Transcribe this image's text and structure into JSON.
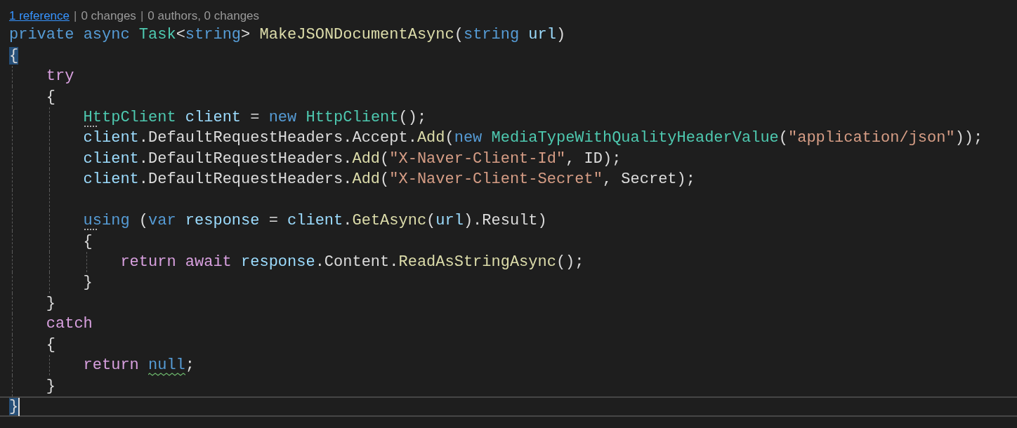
{
  "codelens": [
    {
      "kind": "link",
      "text": "1 reference"
    },
    {
      "kind": "separator",
      "text": "|"
    },
    {
      "kind": "info",
      "text": "0 changes"
    },
    {
      "kind": "separator",
      "text": "|"
    },
    {
      "kind": "info",
      "text": "0 authors, 0 changes"
    }
  ],
  "lines": [
    {
      "kind": "code",
      "tokens": [
        {
          "kind": "keyword",
          "text": "private "
        },
        {
          "kind": "keyword",
          "text": "async "
        },
        {
          "kind": "type",
          "text": "Task"
        },
        {
          "kind": "punct",
          "text": "<"
        },
        {
          "kind": "keyword",
          "text": "string"
        },
        {
          "kind": "punct",
          "text": "> "
        },
        {
          "kind": "method",
          "text": "MakeJSONDocumentAsync"
        },
        {
          "kind": "punct",
          "text": "("
        },
        {
          "kind": "keyword",
          "text": "string "
        },
        {
          "kind": "variable",
          "text": "url"
        },
        {
          "kind": "punct",
          "text": ")"
        }
      ]
    },
    {
      "kind": "code",
      "tokens": [
        {
          "kind": "punct",
          "text": "{",
          "matched": true
        }
      ],
      "children": [
        {
          "kind": "code",
          "tokens": [
            {
              "kind": "control",
              "text": "try"
            }
          ]
        },
        {
          "kind": "code",
          "tokens": [
            {
              "kind": "punct",
              "text": "{"
            }
          ],
          "children": [
            {
              "kind": "code",
              "tokens": [
                {
                  "kind": "type",
                  "text": "HttpClient",
                  "suggestion_dots": true
                },
                {
                  "kind": "variable",
                  "text": " client"
                },
                {
                  "kind": "punct",
                  "text": " = "
                },
                {
                  "kind": "keyword",
                  "text": "new "
                },
                {
                  "kind": "type",
                  "text": "HttpClient"
                },
                {
                  "kind": "punct",
                  "text": "();"
                }
              ]
            },
            {
              "kind": "code",
              "tokens": [
                {
                  "kind": "variable",
                  "text": "client"
                },
                {
                  "kind": "punct",
                  "text": ".DefaultRequestHeaders.Accept."
                },
                {
                  "kind": "method",
                  "text": "Add"
                },
                {
                  "kind": "punct",
                  "text": "("
                },
                {
                  "kind": "keyword",
                  "text": "new "
                },
                {
                  "kind": "type",
                  "text": "MediaTypeWithQualityHeaderValue"
                },
                {
                  "kind": "punct",
                  "text": "("
                },
                {
                  "kind": "string",
                  "text": "\"application/json\""
                },
                {
                  "kind": "punct",
                  "text": "));"
                }
              ]
            },
            {
              "kind": "code",
              "tokens": [
                {
                  "kind": "variable",
                  "text": "client"
                },
                {
                  "kind": "punct",
                  "text": ".DefaultRequestHeaders."
                },
                {
                  "kind": "method",
                  "text": "Add"
                },
                {
                  "kind": "punct",
                  "text": "("
                },
                {
                  "kind": "string",
                  "text": "\"X-Naver-Client-Id\""
                },
                {
                  "kind": "punct",
                  "text": ", ID);"
                }
              ]
            },
            {
              "kind": "code",
              "tokens": [
                {
                  "kind": "variable",
                  "text": "client"
                },
                {
                  "kind": "punct",
                  "text": ".DefaultRequestHeaders."
                },
                {
                  "kind": "method",
                  "text": "Add"
                },
                {
                  "kind": "punct",
                  "text": "("
                },
                {
                  "kind": "string",
                  "text": "\"X-Naver-Client-Secret\""
                },
                {
                  "kind": "punct",
                  "text": ", Secret);"
                }
              ]
            },
            {
              "kind": "blank"
            },
            {
              "kind": "code",
              "tokens": [
                {
                  "kind": "keyword",
                  "text": "using",
                  "suggestion_dots": true
                },
                {
                  "kind": "punct",
                  "text": " ("
                },
                {
                  "kind": "keyword",
                  "text": "var "
                },
                {
                  "kind": "variable",
                  "text": "response"
                },
                {
                  "kind": "punct",
                  "text": " = "
                },
                {
                  "kind": "variable",
                  "text": "client"
                },
                {
                  "kind": "punct",
                  "text": "."
                },
                {
                  "kind": "method",
                  "text": "GetAsync"
                },
                {
                  "kind": "punct",
                  "text": "("
                },
                {
                  "kind": "variable",
                  "text": "url"
                },
                {
                  "kind": "punct",
                  "text": ").Result)"
                }
              ]
            },
            {
              "kind": "code",
              "tokens": [
                {
                  "kind": "punct",
                  "text": "{"
                }
              ],
              "children": [
                {
                  "kind": "code",
                  "tokens": [
                    {
                      "kind": "control",
                      "text": "return "
                    },
                    {
                      "kind": "control",
                      "text": "await "
                    },
                    {
                      "kind": "variable",
                      "text": "response"
                    },
                    {
                      "kind": "punct",
                      "text": ".Content."
                    },
                    {
                      "kind": "method",
                      "text": "ReadAsStringAsync"
                    },
                    {
                      "kind": "punct",
                      "text": "();"
                    }
                  ]
                }
              ]
            },
            {
              "kind": "code",
              "tokens": [
                {
                  "kind": "punct",
                  "text": "}"
                }
              ]
            }
          ]
        },
        {
          "kind": "code",
          "tokens": [
            {
              "kind": "punct",
              "text": "}"
            }
          ]
        },
        {
          "kind": "code",
          "tokens": [
            {
              "kind": "control",
              "text": "catch"
            }
          ]
        },
        {
          "kind": "code",
          "tokens": [
            {
              "kind": "punct",
              "text": "{"
            }
          ],
          "children": [
            {
              "kind": "code",
              "tokens": [
                {
                  "kind": "control",
                  "text": "return "
                },
                {
                  "kind": "keyword",
                  "text": "null",
                  "warning_squiggle": true
                },
                {
                  "kind": "punct",
                  "text": ";"
                }
              ]
            }
          ]
        },
        {
          "kind": "code",
          "tokens": [
            {
              "kind": "punct",
              "text": "}"
            }
          ]
        }
      ]
    },
    {
      "kind": "code",
      "current": true,
      "tokens": [
        {
          "kind": "punct",
          "text": "}",
          "matched": true
        }
      ]
    }
  ]
}
